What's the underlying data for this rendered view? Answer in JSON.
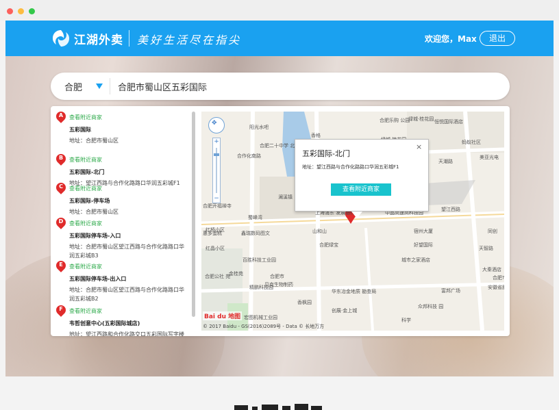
{
  "header": {
    "brand": "江湖外卖",
    "slogan": "美好生活尽在指尖",
    "welcome": "欢迎您，Max",
    "logout_label": "退出",
    "color": "#1aa1f0"
  },
  "search": {
    "city": "合肥",
    "address": "合肥市蜀山区五彩国际"
  },
  "results": [
    {
      "marker": "A",
      "link": "查看附近商家",
      "name": "五彩国际",
      "address": "地址：合肥市蜀山区"
    },
    {
      "marker": "B",
      "link": "查看附近商家",
      "name": "五彩国际-北门",
      "address": "地址：望江西路与合作化路路口华润五彩城F1"
    },
    {
      "marker": "C",
      "link": "查看附近商家",
      "name": "五彩国际-停车场",
      "address": "地址：合肥市蜀山区"
    },
    {
      "marker": "D",
      "link": "查看附近商家",
      "name": "五彩国际停车场-入口",
      "address": "地址：合肥市蜀山区望江西路与合作化路路口华润五彩城B3"
    },
    {
      "marker": "E",
      "link": "查看附近商家",
      "name": "五彩国际停车场-出入口",
      "address": "地址：合肥市蜀山区望江西路与合作化路路口华润五彩城B2"
    },
    {
      "marker": "F",
      "link": "查看附近商家",
      "name": "韦哲创意中心(五彩国际城店)",
      "address": "地址：望江西路和合作化路交口五彩国际写字楼"
    }
  ],
  "map": {
    "popup": {
      "title": "五彩国际-北门",
      "close": "×",
      "address": "地址：望江西路与合作化路路口华润五彩城F1",
      "button": "查看附近商家"
    },
    "labels": {
      "l1": "阳光水吧",
      "l2": "香格",
      "l3": "合肥二十中学\n北校区",
      "l4": "合作化南路",
      "l5": "澜溪镇",
      "l6": "合肥开福禅寺",
      "l7": "蜀峰湾",
      "l8": "上海浦东\n发展银行",
      "l9": "望江西路",
      "l10": "望江西路",
      "l11": "鑫瑞数码图文",
      "l12": "红晶小区",
      "l13": "合肥绿宝",
      "l14": "蚂蚁社区",
      "l15": "天潮路",
      "l16": "美亚光电",
      "l17": "绿城·桂花园",
      "l18": "绿城·桂花园",
      "l19": "恒悦国际酒店",
      "l20": "宿州大厦",
      "l21": "城市之家酒店",
      "l22": "百胜科技工业园",
      "l23": "合肥市",
      "l24": "贝克生物制药",
      "l25": "华东冶金地质\n勘查局",
      "l26": "富邦广场",
      "l27": "香枫园",
      "l28": "创展·金上城",
      "l29": "宏图机械工业园",
      "l30": "科学",
      "l31": "天智路",
      "l32": "众邦科技\n园",
      "l33": "好望国际",
      "l34": "红桥小区",
      "l35": "大秦酒店",
      "l36": "合肥市二十",
      "l37": "安徽省肥",
      "l38": "同创",
      "l39": "中晶高速高科技园",
      "l40": "惠多蛋糕",
      "l41": "合肥乐购\n公园",
      "l42": "山和山",
      "l43": "精鹏科技园",
      "l44": "金桂苑",
      "l45": "合肥公社\n苑",
      "l46": "合作化路"
    },
    "copyright": "© 2017 Baidu - GS(2016)2089号 - Data © 长地万方",
    "baidu_logo": "Bai du 地图"
  }
}
